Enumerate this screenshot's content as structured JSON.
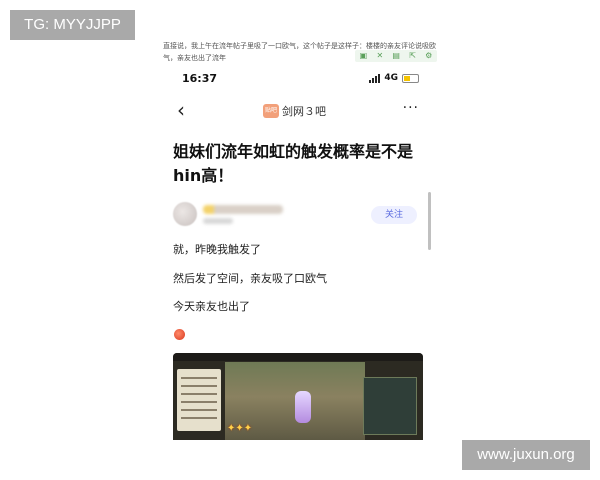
{
  "badges": {
    "tg": "TG: MYYJJPP",
    "site": "www.juxun.org"
  },
  "caption": "直接说，我上午在流年帖子里吸了一口欧气，这个帖子是这样子：楼楼的亲友评论说吸欧气，亲友也出了流年",
  "mini_toolbar": {
    "icons": [
      "book-icon",
      "expand-icon",
      "copy-icon",
      "share-icon",
      "settings-icon"
    ],
    "glyphs": [
      "▣",
      "✕",
      "▤",
      "⇱",
      "⚙"
    ]
  },
  "status_bar": {
    "time": "16:37",
    "network": "4G"
  },
  "nav": {
    "back_glyph": "‹",
    "bar_logo_text": "贴吧",
    "bar_name": "剑网３吧",
    "more_glyph": "···"
  },
  "post": {
    "title": "姐妹们流年如虹的触发概率是不是hin高！",
    "follow_label": "关注",
    "paragraphs": [
      "就，昨晚我触发了",
      "然后发了空间，亲友吸了口欧气",
      "今天亲友也出了"
    ]
  },
  "colors": {
    "follow_text": "#5a6adf",
    "follow_bg": "#eef0ff"
  }
}
